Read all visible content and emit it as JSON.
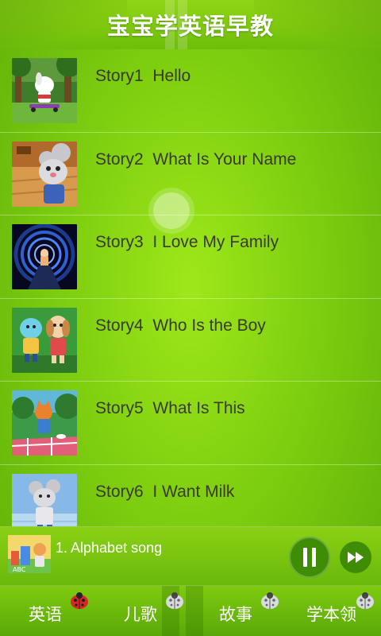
{
  "header": {
    "title": "宝宝学英语早教"
  },
  "stories": [
    {
      "number": "Story1",
      "title": "Hello",
      "thumb_icon": "dog-skateboard-icon"
    },
    {
      "number": "Story2",
      "title": "What Is Your Name",
      "thumb_icon": "mouse-icon"
    },
    {
      "number": "Story3",
      "title": "I Love My Family",
      "thumb_icon": "tunnel-icon"
    },
    {
      "number": "Story4",
      "title": "Who Is the Boy",
      "thumb_icon": "cat-dog-icon"
    },
    {
      "number": "Story5",
      "title": "What Is This",
      "thumb_icon": "fox-picnic-icon"
    },
    {
      "number": "Story6",
      "title": "I Want Milk",
      "thumb_icon": "mouse-milk-icon"
    }
  ],
  "player": {
    "now_playing": "1. Alphabet song",
    "pause_icon": "pause-icon",
    "next_icon": "fast-forward-icon"
  },
  "nav": {
    "items": [
      {
        "label": "英语",
        "icon": "ladybug-icon"
      },
      {
        "label": "儿歌",
        "icon": "beetle-icon"
      },
      {
        "label": "故事",
        "icon": "beetle-icon"
      },
      {
        "label": "学本领",
        "icon": "beetle-icon"
      }
    ]
  },
  "colors": {
    "accent": "#7fcf10",
    "title_text": "#3a3a2a",
    "button_dark": "#3e8d05"
  }
}
